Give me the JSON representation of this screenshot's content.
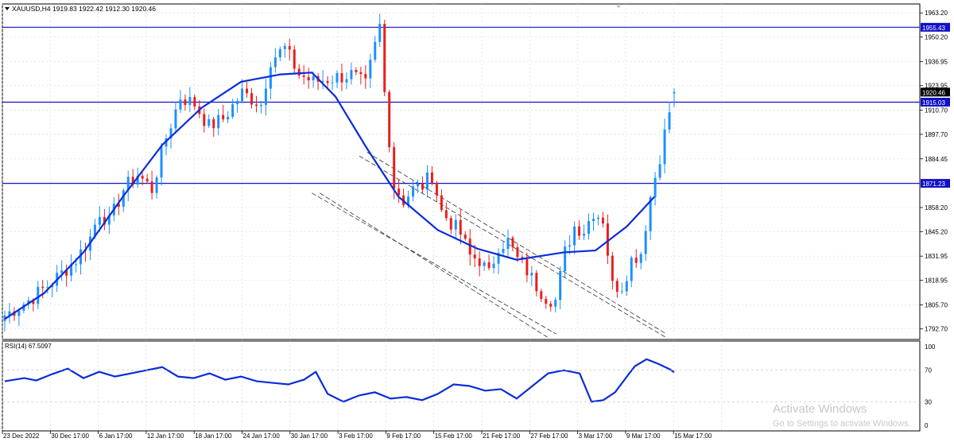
{
  "symbol_header": "XAUUSD,H4  1919.83 1922.42 1912.30 1920.46",
  "rsi_header": "RSI(14) 67.5097",
  "watermark": {
    "title": "Activate Windows",
    "subtitle": "Go to Settings to activate Windows."
  },
  "icons": [
    "dropdown-triangle-icon",
    "scroll-arrow-icon"
  ],
  "colors": {
    "bull_candle": "#1e90ff",
    "bear_candle": "#e8201e",
    "moving_average": "#0a2cd8",
    "horizontal_line": "#1010c8",
    "price_label_bg": "#1010c8",
    "channel_line": "#333333",
    "rsi_line": "#0a2cd8",
    "grid": "#d8d8d8"
  },
  "price_axis_labels": [
    "1963.20",
    "1950.20",
    "1936.95",
    "1923.95",
    "1910.70",
    "1897.70",
    "1884.45",
    "1858.20",
    "1845.20",
    "1831.95",
    "1818.95",
    "1805.70",
    "1792.70"
  ],
  "current_price_label": "1920.46",
  "horizontal_levels": [
    {
      "label": "1955.43",
      "price": 1955.43
    },
    {
      "label": "1915.03",
      "price": 1915.03
    },
    {
      "label": "1871.23",
      "price": 1871.23
    }
  ],
  "rsi_axis_labels": [
    "100",
    "70",
    "30",
    "0"
  ],
  "time_axis_labels": [
    "23 Dec 2022",
    "30 Dec 17:00",
    "6 Jan 17:00",
    "12 Jan 17:00",
    "18 Jan 17:00",
    "24 Jan 17:00",
    "30 Jan 17:00",
    "3 Feb 17:00",
    "9 Feb 17:00",
    "15 Feb 17:00",
    "21 Feb 17:00",
    "27 Feb 17:00",
    "3 Mar 17:00",
    "9 Mar 17:00",
    "15 Mar 17:00"
  ],
  "chart_data": {
    "type": "candlestick",
    "title": "XAUUSD,H4",
    "ohlc_last": {
      "open": 1919.83,
      "high": 1922.42,
      "low": 1912.3,
      "close": 1920.46
    },
    "price_range": [
      1787,
      1968
    ],
    "rsi_range": [
      0,
      100
    ],
    "bar_count": 142,
    "anchor_prices": [
      1800,
      1808,
      1818,
      1830,
      1842,
      1856,
      1850,
      1868,
      1876,
      1868,
      1896,
      1918,
      1914,
      1902,
      1906,
      1920,
      1914,
      1938,
      1944,
      1930,
      1926,
      1928,
      1930,
      1924,
      1956,
      1920,
      1870,
      1862,
      1868,
      1870,
      1876,
      1856,
      1850,
      1844,
      1832,
      1830,
      1822,
      1838,
      1840,
      1830,
      1824,
      1816,
      1810,
      1808,
      1834,
      1848,
      1846,
      1856,
      1852,
      1816,
      1816,
      1830,
      1834,
      1864,
      1886,
      1910,
      1906,
      1900,
      1934,
      1920
    ],
    "anchor_bars": [
      0,
      5,
      10,
      15,
      18,
      20,
      22,
      25,
      28,
      31,
      34,
      37,
      40,
      43,
      46,
      50,
      54,
      56,
      59,
      62,
      65,
      69,
      73,
      76,
      79,
      80,
      82,
      84,
      86,
      88,
      90,
      92,
      94,
      96,
      98,
      100,
      102,
      104,
      106,
      108,
      110,
      112,
      114,
      116,
      118,
      120,
      122,
      124,
      126,
      128,
      130,
      132,
      134,
      136,
      138,
      140,
      142,
      144,
      146,
      148
    ],
    "moving_average_anchors": [
      {
        "bar": 0,
        "price": 1798
      },
      {
        "bar": 10,
        "price": 1812
      },
      {
        "bar": 20,
        "price": 1834
      },
      {
        "bar": 30,
        "price": 1864
      },
      {
        "bar": 40,
        "price": 1892
      },
      {
        "bar": 50,
        "price": 1912
      },
      {
        "bar": 60,
        "price": 1926
      },
      {
        "bar": 70,
        "price": 1930
      },
      {
        "bar": 78,
        "price": 1931
      },
      {
        "bar": 84,
        "price": 1918
      },
      {
        "bar": 92,
        "price": 1890
      },
      {
        "bar": 100,
        "price": 1864
      },
      {
        "bar": 110,
        "price": 1846
      },
      {
        "bar": 120,
        "price": 1836
      },
      {
        "bar": 130,
        "price": 1830
      },
      {
        "bar": 136,
        "price": 1832
      },
      {
        "bar": 142,
        "price": 1834
      },
      {
        "bar": 150,
        "price": 1835
      },
      {
        "bar": 158,
        "price": 1848
      },
      {
        "bar": 165,
        "price": 1864
      }
    ],
    "channel_lines": [
      {
        "from": {
          "bar": 92,
          "price": 1888
        },
        "to": {
          "bar": 168,
          "price": 1790
        }
      },
      {
        "from": {
          "bar": 90,
          "price": 1886
        },
        "to": {
          "bar": 168,
          "price": 1788
        }
      },
      {
        "from": {
          "bar": 78,
          "price": 1866
        },
        "to": {
          "bar": 140,
          "price": 1790
        }
      },
      {
        "from": {
          "bar": 80,
          "price": 1866
        },
        "to": {
          "bar": 138,
          "price": 1788
        }
      }
    ],
    "rsi_anchors": [
      {
        "bar": 0,
        "value": 56
      },
      {
        "bar": 5,
        "value": 60
      },
      {
        "bar": 8,
        "value": 57
      },
      {
        "bar": 12,
        "value": 65
      },
      {
        "bar": 16,
        "value": 72
      },
      {
        "bar": 20,
        "value": 60
      },
      {
        "bar": 24,
        "value": 68
      },
      {
        "bar": 28,
        "value": 62
      },
      {
        "bar": 32,
        "value": 66
      },
      {
        "bar": 36,
        "value": 70
      },
      {
        "bar": 40,
        "value": 74
      },
      {
        "bar": 44,
        "value": 62
      },
      {
        "bar": 48,
        "value": 60
      },
      {
        "bar": 52,
        "value": 66
      },
      {
        "bar": 56,
        "value": 58
      },
      {
        "bar": 60,
        "value": 62
      },
      {
        "bar": 64,
        "value": 56
      },
      {
        "bar": 68,
        "value": 54
      },
      {
        "bar": 72,
        "value": 52
      },
      {
        "bar": 76,
        "value": 58
      },
      {
        "bar": 79,
        "value": 68
      },
      {
        "bar": 82,
        "value": 40
      },
      {
        "bar": 86,
        "value": 30
      },
      {
        "bar": 90,
        "value": 38
      },
      {
        "bar": 94,
        "value": 42
      },
      {
        "bar": 98,
        "value": 34
      },
      {
        "bar": 102,
        "value": 36
      },
      {
        "bar": 106,
        "value": 32
      },
      {
        "bar": 110,
        "value": 40
      },
      {
        "bar": 114,
        "value": 52
      },
      {
        "bar": 118,
        "value": 50
      },
      {
        "bar": 122,
        "value": 44
      },
      {
        "bar": 126,
        "value": 46
      },
      {
        "bar": 130,
        "value": 34
      },
      {
        "bar": 134,
        "value": 50
      },
      {
        "bar": 138,
        "value": 66
      },
      {
        "bar": 142,
        "value": 70
      },
      {
        "bar": 146,
        "value": 66
      },
      {
        "bar": 149,
        "value": 30
      },
      {
        "bar": 152,
        "value": 32
      },
      {
        "bar": 155,
        "value": 42
      },
      {
        "bar": 158,
        "value": 62
      },
      {
        "bar": 160,
        "value": 75
      },
      {
        "bar": 163,
        "value": 84
      },
      {
        "bar": 166,
        "value": 78
      },
      {
        "bar": 169,
        "value": 71
      },
      {
        "bar": 170,
        "value": 67.5
      }
    ]
  }
}
